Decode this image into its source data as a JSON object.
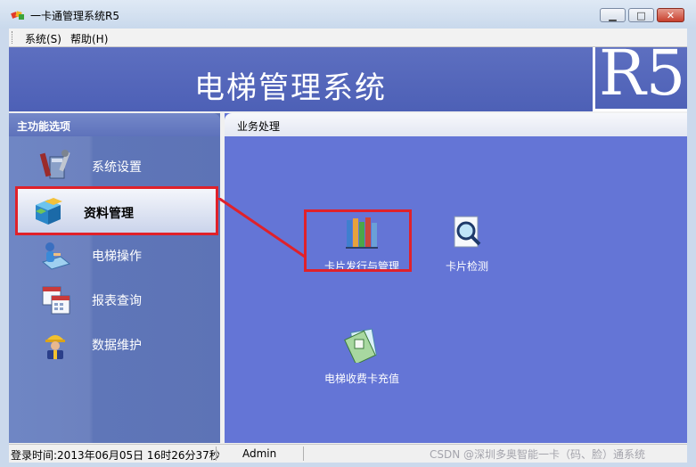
{
  "window": {
    "title": "一卡通管理系统R5",
    "minimize": "▁",
    "maximize": "□",
    "close": "✕"
  },
  "menu": {
    "system": "系统(S)",
    "help": "帮助(H)"
  },
  "banner": {
    "title": "电梯管理系统",
    "logo": "R5"
  },
  "left_panel": {
    "header": "主功能选项",
    "items": [
      {
        "label": "系统设置",
        "icon": "tools-icon"
      },
      {
        "label": "资料管理",
        "icon": "boxes-icon",
        "active": true
      },
      {
        "label": "电梯操作",
        "icon": "elevator-operation-icon"
      },
      {
        "label": "报表查询",
        "icon": "calendar-report-icon"
      },
      {
        "label": "数据维护",
        "icon": "worker-icon"
      }
    ]
  },
  "right_panel": {
    "header": "业务处理",
    "functions": [
      {
        "label": "卡片发行与管理",
        "icon": "books-icon"
      },
      {
        "label": "卡片检测",
        "icon": "magnifier-icon"
      },
      {
        "label": "电梯收费卡充值",
        "icon": "card-recharge-icon"
      }
    ]
  },
  "status": {
    "login_time": "登录时间:2013年06月05日 16时26分37秒",
    "user": "Admin"
  },
  "watermark": "CSDN @深圳多奥智能一卡（码、脸）通系统",
  "colors": {
    "highlight": "#e0212a",
    "workspace": "#6475d6",
    "banner": "#5465b9"
  }
}
